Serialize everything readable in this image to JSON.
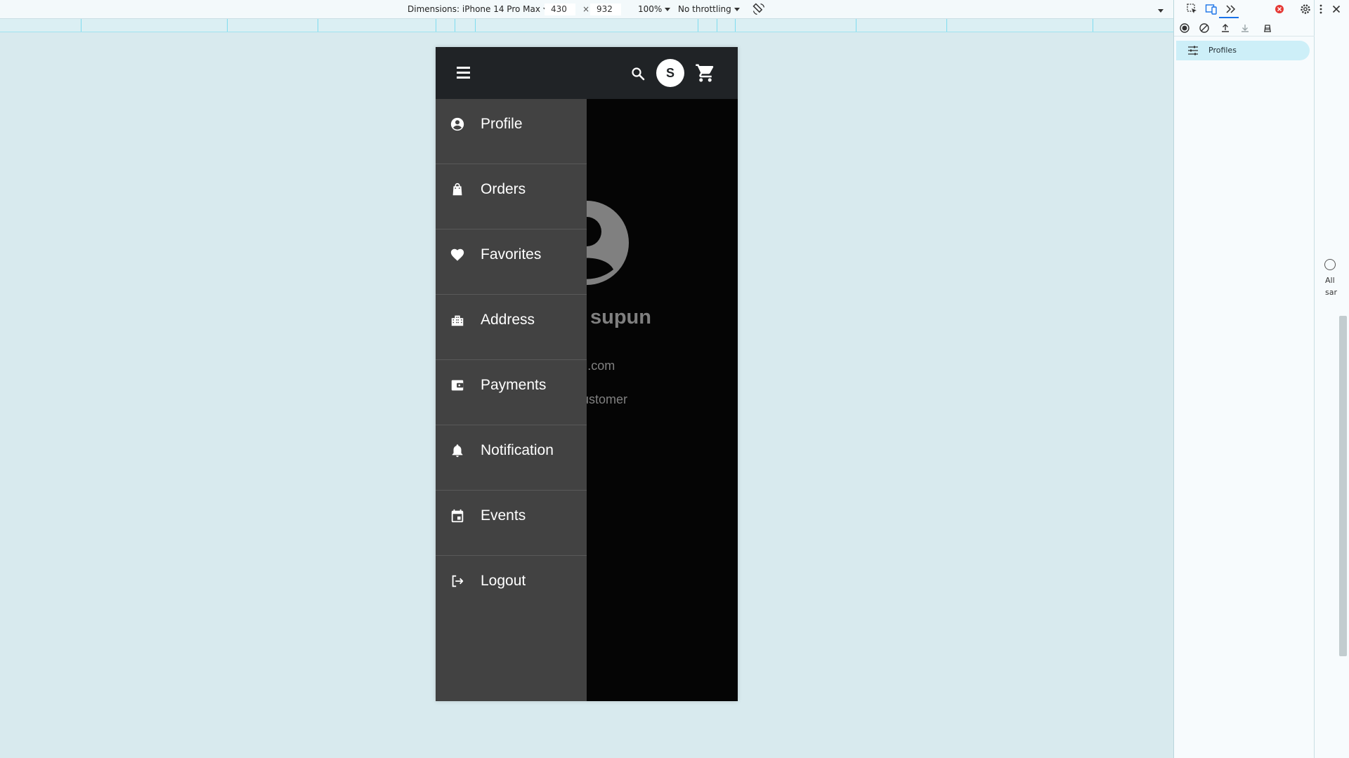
{
  "toolbar": {
    "dimensions_label": "Dimensions: iPhone 14 Pro Max",
    "width_value": "430",
    "times": "×",
    "height_value": "932",
    "zoom": "100%",
    "throttling": "No throttling"
  },
  "app": {
    "avatar_initial": "S",
    "profile": {
      "name": "supun",
      "email_visible": "n@mail.com",
      "role_visible": "e : Customer"
    },
    "menu": [
      {
        "label": "Profile",
        "icon": "account-circle-icon"
      },
      {
        "label": "Orders",
        "icon": "shopping-bag-icon"
      },
      {
        "label": "Favorites",
        "icon": "heart-icon"
      },
      {
        "label": "Address",
        "icon": "building-icon"
      },
      {
        "label": "Payments",
        "icon": "wallet-icon"
      },
      {
        "label": "Notification",
        "icon": "bell-icon"
      },
      {
        "label": "Events",
        "icon": "calendar-icon"
      },
      {
        "label": "Logout",
        "icon": "logout-icon"
      }
    ]
  },
  "devtools": {
    "profiles_label": "Profiles",
    "side_text_1": "All",
    "side_text_2": "sar"
  },
  "colors": {
    "page_bg": "#d8eaee",
    "appbar": "#202326",
    "drawer": "#424242",
    "content_bg": "#050505",
    "selected_panel_item": "#cdeff8"
  }
}
